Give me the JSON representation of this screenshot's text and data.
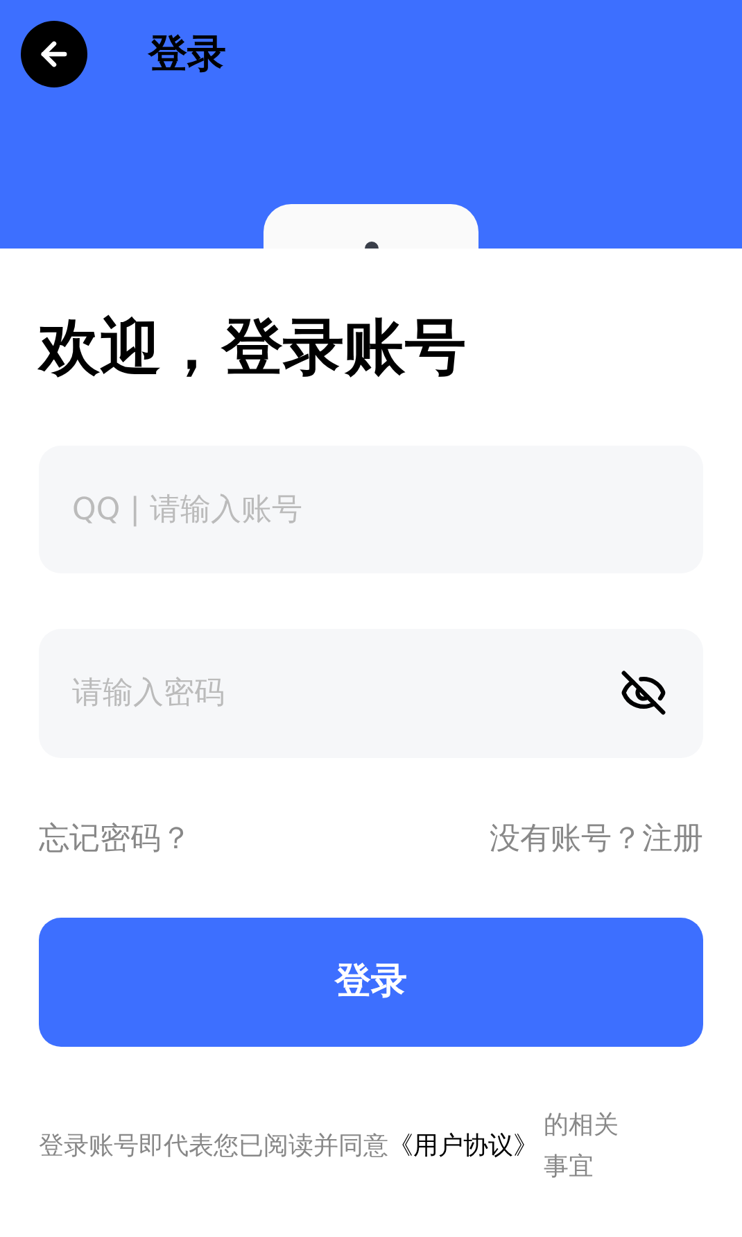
{
  "header": {
    "title": "登录"
  },
  "welcome": "欢迎，登录账号",
  "account_field": {
    "placeholder": "QQ | 请输入账号"
  },
  "password_field": {
    "placeholder": "请输入密码",
    "visible": false
  },
  "forgot_link": "忘记密码？",
  "register": {
    "prompt": "没有账号？",
    "link": "注册"
  },
  "login_button": "登录",
  "agreement": {
    "text": "登录账号即代表您已阅读并同意",
    "link": "《用户协议》",
    "suffix": "的相关事宜"
  }
}
